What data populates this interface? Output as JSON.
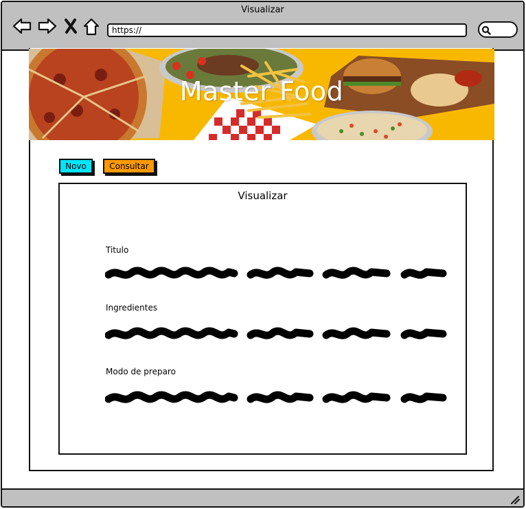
{
  "window": {
    "title": "Visualizar"
  },
  "browser": {
    "url": "https://",
    "icons": [
      "back-arrow-icon",
      "forward-arrow-icon",
      "close-x-icon",
      "home-icon",
      "search-icon"
    ]
  },
  "banner": {
    "title": "Master Food"
  },
  "toolbar": {
    "novo_label": "Novo",
    "consultar_label": "Consultar"
  },
  "panel": {
    "title": "Visualizar",
    "fields": [
      {
        "label": "Titulo"
      },
      {
        "label": "Ingredientes"
      },
      {
        "label": "Modo de preparo"
      }
    ]
  },
  "colors": {
    "titlebar": "#c0c0c0",
    "banner_bg": "#f9b800",
    "novo_button": "#00e5ff",
    "consultar_button": "#ff9900"
  }
}
